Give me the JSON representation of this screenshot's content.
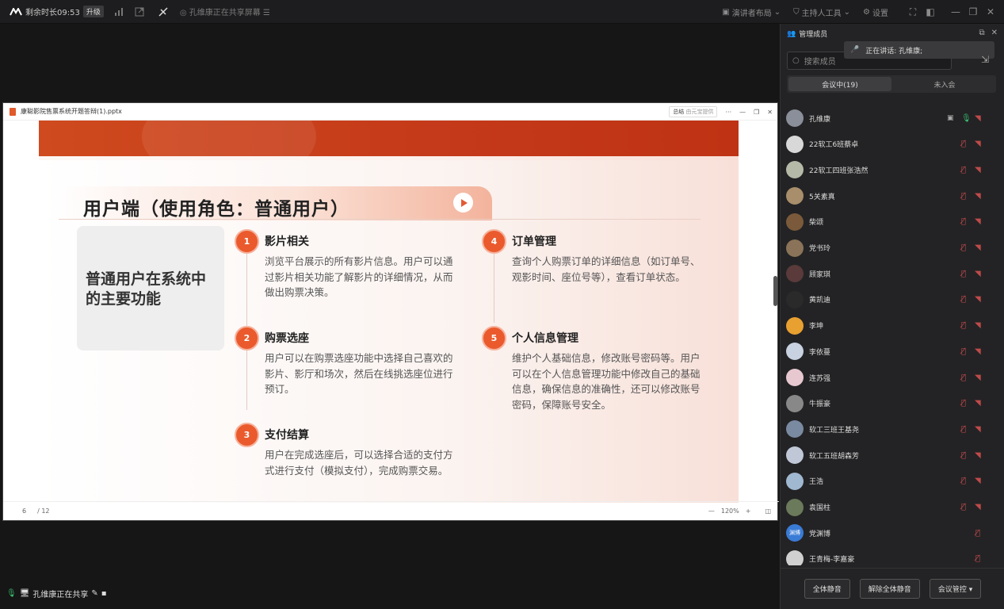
{
  "topbar": {
    "remaining_time": "剩余时长09:53",
    "upgrade_label": "升级",
    "sharing_status": "孔维康正在共享屏幕",
    "right_items": [
      "演讲者布局",
      "主持人工具",
      "设置"
    ],
    "icon_names": [
      "signal-icon",
      "share-out-icon",
      "annotate-off-icon",
      "layout-icon",
      "shield-icon",
      "gear-icon",
      "fullscreen-icon",
      "sidebar-icon",
      "minimize-icon",
      "restore-icon",
      "close-icon"
    ]
  },
  "ppt": {
    "filename": "康聪影院售票系统开题答辩(1).pptx",
    "summary_label": "总结",
    "summary_sub": "由元宝提供",
    "page_current": "6",
    "page_total": "/ 12",
    "zoom": "120%",
    "slide": {
      "title": "用户端（使用角色：普通用户）",
      "left_card": "普通用户在系统中的主要功能",
      "items": [
        {
          "num": "1",
          "title": "影片相关",
          "body": "浏览平台展示的所有影片信息。用户可以通过影片相关功能了解影片的详细情况，从而做出购票决策。"
        },
        {
          "num": "2",
          "title": "购票选座",
          "body": "用户可以在购票选座功能中选择自己喜欢的影片、影厅和场次，然后在线挑选座位进行预订。"
        },
        {
          "num": "3",
          "title": "支付结算",
          "body": "用户在完成选座后，可以选择合适的支付方式进行支付（模拟支付），完成购票交易。"
        },
        {
          "num": "4",
          "title": "订单管理",
          "body": "查询个人购票订单的详细信息（如订单号、观影时间、座位号等），查看订单状态。"
        },
        {
          "num": "5",
          "title": "个人信息管理",
          "body": "维护个人基础信息，修改账号密码等。用户可以在个人信息管理功能中修改自己的基础信息，确保信息的准确性，还可以修改账号密码，保障账号安全。"
        }
      ]
    }
  },
  "bottom_share": "孔维康正在共享",
  "panel": {
    "title": "管理成员",
    "speaking": "正在讲话:   孔维康;",
    "search_placeholder": "搜索成员",
    "tab_in": "会议中(19)",
    "tab_out": "未入会",
    "members": [
      {
        "name": "孔维康",
        "color": "#8a8f99",
        "mic": "on",
        "screen": true
      },
      {
        "name": "22软工6班蔡卓",
        "color": "#d8d8d8"
      },
      {
        "name": "22软工四班张浩然",
        "color": "#b5b9a8"
      },
      {
        "name": "5关素真",
        "color": "#a88e6a"
      },
      {
        "name": "柴颂",
        "color": "#7a5a3a"
      },
      {
        "name": "党书玲",
        "color": "#8a7358"
      },
      {
        "name": "顾家琪",
        "color": "#5a3a3a"
      },
      {
        "name": "黄凯迪",
        "color": "#2a2a2a"
      },
      {
        "name": "李坤",
        "color": "#e8a030"
      },
      {
        "name": "李依蔓",
        "color": "#c8d2e0"
      },
      {
        "name": "连苏强",
        "color": "#e8c8d0"
      },
      {
        "name": "牛振豪",
        "color": "#888888"
      },
      {
        "name": "软工三班王基尧",
        "color": "#7a8aa0"
      },
      {
        "name": "软工五班胡森芳",
        "color": "#c0c8d8"
      },
      {
        "name": "王浩",
        "color": "#a0b8d0"
      },
      {
        "name": "袁国柱",
        "color": "#6a7a5a"
      },
      {
        "name": "党渊博",
        "color": "#3a7bd5",
        "initials": "渊博",
        "cam": false
      },
      {
        "name": "王青梅-李嘉豪",
        "color": "#d0d0d0",
        "cam": false
      }
    ],
    "mute_all": "全体静音",
    "unmute_all": "解除全体静音",
    "meeting_control": "会议管控"
  }
}
